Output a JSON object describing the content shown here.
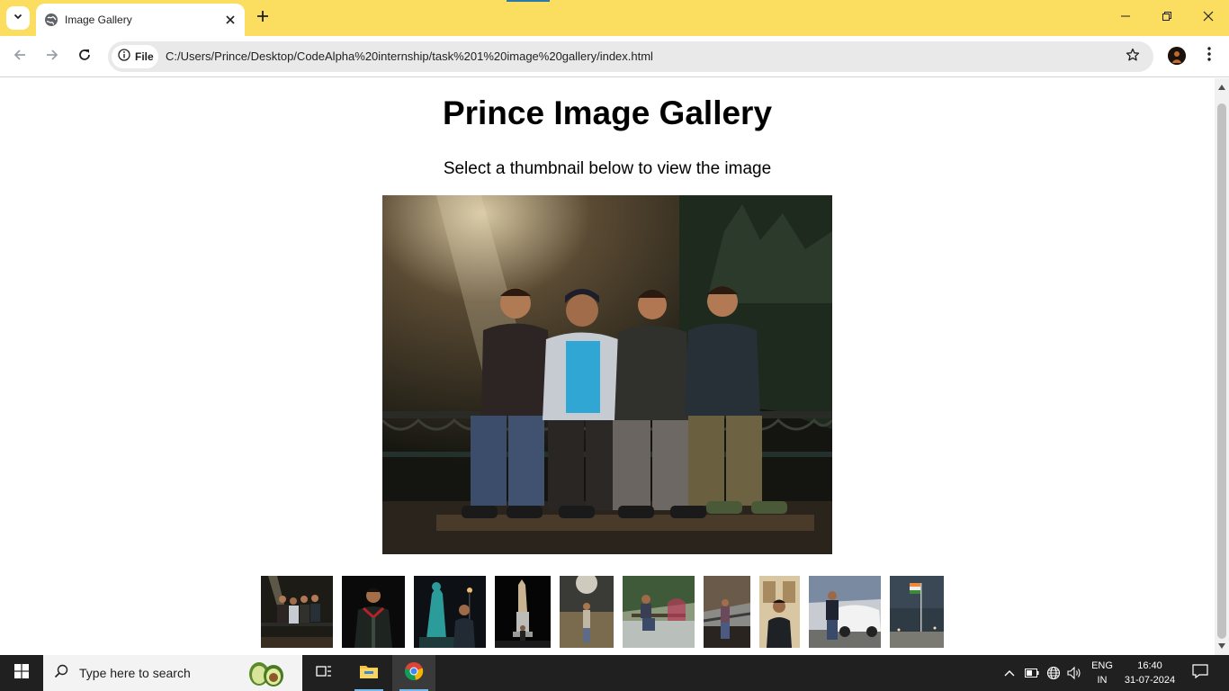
{
  "browser": {
    "tab_title": "Image Gallery",
    "site_chip_label": "File",
    "url": "C:/Users/Prince/Desktop/CodeAlpha%20internship/task%201%20image%20gallery/index.html"
  },
  "page": {
    "title": "Prince Image Gallery",
    "subtitle": "Select a thumbnail below to view the image",
    "main_image": "group-photo-night-bench",
    "thumbnails": [
      "group-night-bench",
      "man-dark-jacket-night",
      "statue-fountain-night",
      "statue-pedestal-night",
      "man-under-lamp",
      "man-on-bench-garden",
      "man-on-bridge",
      "man-selfie-indoor",
      "man-beside-car",
      "flag-at-night"
    ]
  },
  "taskbar": {
    "search_placeholder": "Type here to search",
    "language_line1": "ENG",
    "language_line2": "IN",
    "time": "16:40",
    "date": "31-07-2024"
  },
  "colors": {
    "titlebar": "#fbdd60",
    "taskbar": "#202020",
    "omnibox": "#e9e9e9"
  }
}
